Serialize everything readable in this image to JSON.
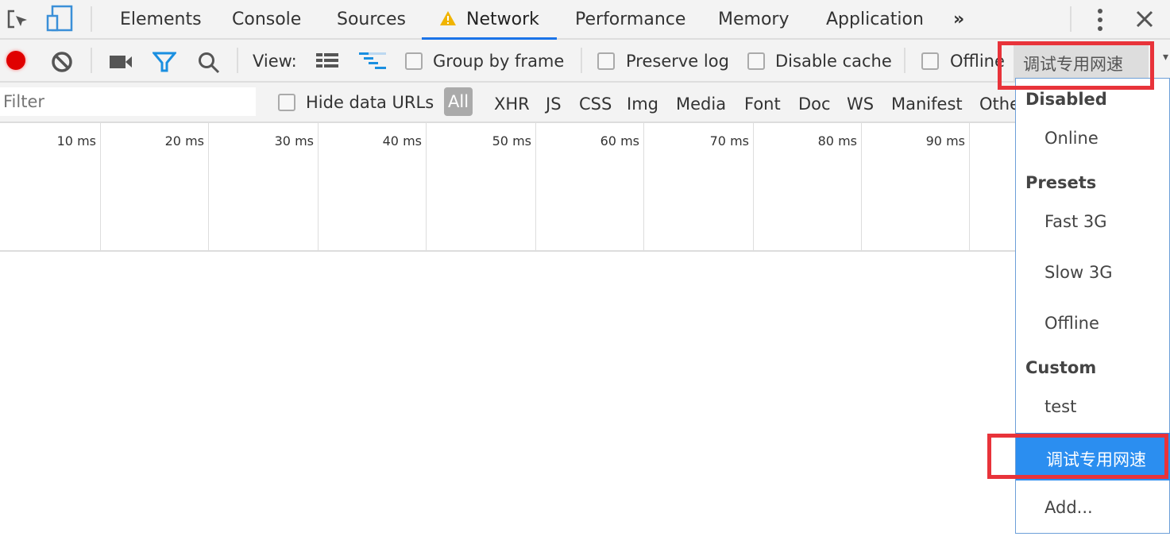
{
  "tabs": [
    "Elements",
    "Console",
    "Sources",
    "Network",
    "Performance",
    "Memory",
    "Application"
  ],
  "toolbar": {
    "view_label": "View:",
    "group_by_frame": "Group by frame",
    "preserve_log": "Preserve log",
    "disable_cache": "Disable cache",
    "offline": "Offline",
    "throttle_selected": "调试专用网速"
  },
  "filter": {
    "placeholder": "Filter",
    "hide_data_urls": "Hide data URLs",
    "types": [
      "All",
      "XHR",
      "JS",
      "CSS",
      "Img",
      "Media",
      "Font",
      "Doc",
      "WS",
      "Manifest",
      "Othe"
    ]
  },
  "timeline": {
    "ticks": [
      "10 ms",
      "20 ms",
      "30 ms",
      "40 ms",
      "50 ms",
      "60 ms",
      "70 ms",
      "80 ms",
      "90 ms"
    ]
  },
  "menu": {
    "disabled_header": "Disabled",
    "online": "Online",
    "presets_header": "Presets",
    "fast3g": "Fast 3G",
    "slow3g": "Slow 3G",
    "offline": "Offline",
    "custom_header": "Custom",
    "test": "test",
    "selected": "调试专用网速",
    "add": "Add..."
  },
  "colors": {
    "accent": "#1a73e8",
    "record": "#e00000",
    "selected_bg": "#2b8ef0",
    "highlight": "#e8333a"
  }
}
